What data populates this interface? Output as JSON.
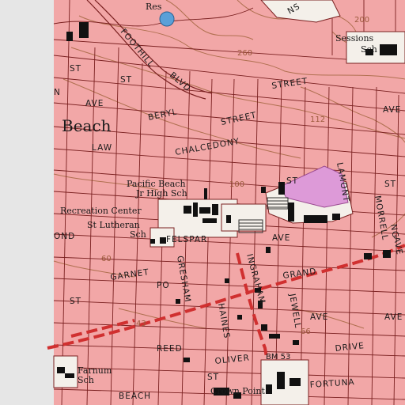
{
  "map": {
    "colors": {
      "urban_tint": "#f2a7a7",
      "margin": "#e6e6e6",
      "street_casing": "#7a2020",
      "contour": "#b07050",
      "major_road": "#d03030",
      "building": "#111111",
      "park": "#f4f0ea",
      "purple_area": "#dd9ad8",
      "water": "#5aa0d8"
    },
    "place_labels": {
      "beach": "Beach",
      "res": "Res",
      "sessions_sch_1": "Sessions",
      "sessions_sch_2": "Sch",
      "pacific_beach_1": "Pacific Beach",
      "pacific_beach_2": "Jr High Sch",
      "recreation_center": "Recreation Center",
      "st_lutheran_1": "St Lutheran",
      "st_lutheran_2": "Sch",
      "farnum_1": "Farnum",
      "farnum_2": "Sch",
      "crown_point": "Crown Point"
    },
    "street_labels": {
      "foothill": "FOOTHILL",
      "blvd": "BLVD",
      "street1": "STREET",
      "st_left": "ST",
      "st_left2": "ST",
      "ave_left": "AVE",
      "beryl": "BERYL",
      "street2": "STREET",
      "law": "LAW",
      "chalcedony": "CHALCEDONY",
      "st_mid": "ST",
      "lamont": "LAMONT",
      "morrell": "MORRELL",
      "ond": "OND",
      "felspar": "FELSPAR",
      "ave_mid": "AVE",
      "garnet": "GARNET",
      "po": "PO",
      "grand": "GRAND",
      "gresham": "GRESHAM",
      "ingraham": "INGRAHAM",
      "haines": "HAINES",
      "jewell": "JEWELL",
      "ave_low": "AVE",
      "ave_right": "AVE",
      "reed": "REED",
      "oliver": "OLIVER",
      "drive": "DRIVE",
      "st_left3": "ST",
      "beach_st": "BEACH",
      "fortuna": "FORTUNA",
      "ns": "NS",
      "st_mid2": "ST",
      "n": "N",
      "st_right": "ST",
      "ave_rt": "AVE",
      "ng": "NG",
      "ave_rr": "AVE"
    },
    "elevations": {
      "e100": "100",
      "e112": "112",
      "e260": "260",
      "e200": "200",
      "e60": "60",
      "e43": "43",
      "e66": "66",
      "bm": "BM 53"
    }
  }
}
